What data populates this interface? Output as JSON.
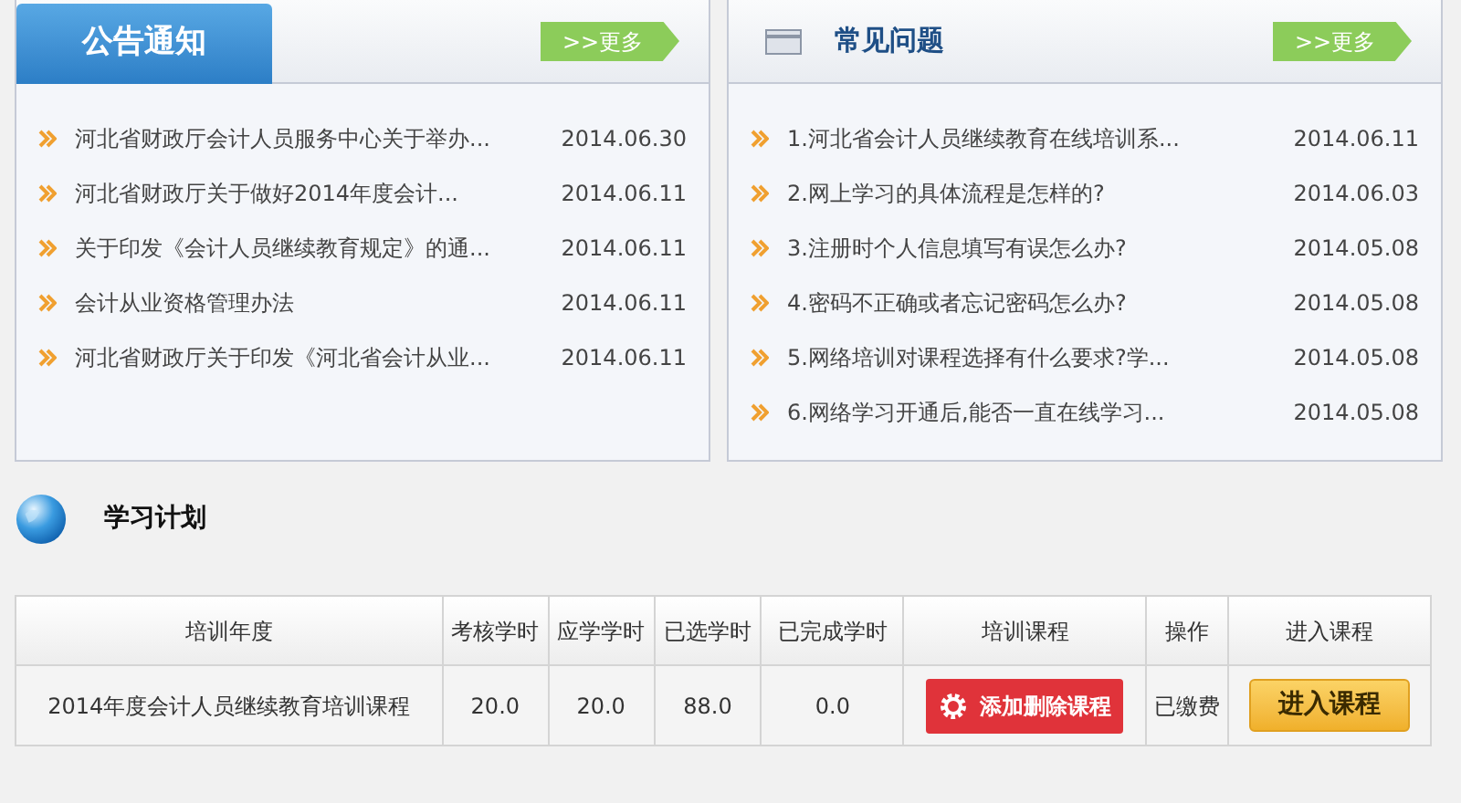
{
  "notices": {
    "title": "公告通知",
    "more": ">>更多",
    "items": [
      {
        "text": "河北省财政厅会计人员服务中心关于举办...",
        "date": "2014.06.30"
      },
      {
        "text": "河北省财政厅关于做好2014年度会计...",
        "date": "2014.06.11"
      },
      {
        "text": "关于印发《会计人员继续教育规定》的通...",
        "date": "2014.06.11"
      },
      {
        "text": "会计从业资格管理办法",
        "date": "2014.06.11"
      },
      {
        "text": "河北省财政厅关于印发《河北省会计从业...",
        "date": "2014.06.11"
      }
    ]
  },
  "faq": {
    "title": "常见问题",
    "more": ">>更多",
    "items": [
      {
        "text": "1.河北省会计人员继续教育在线培训系...",
        "date": "2014.06.11"
      },
      {
        "text": "2.网上学习的具体流程是怎样的?",
        "date": "2014.06.03"
      },
      {
        "text": "3.注册时个人信息填写有误怎么办?",
        "date": "2014.05.08"
      },
      {
        "text": "4.密码不正确或者忘记密码怎么办?",
        "date": "2014.05.08"
      },
      {
        "text": "5.网络培训对课程选择有什么要求?学...",
        "date": "2014.05.08"
      },
      {
        "text": "6.网络学习开通后,能否一直在线学习...",
        "date": "2014.05.08"
      }
    ]
  },
  "study_plan": {
    "title": "学习计划",
    "table": {
      "columns": [
        "培训年度",
        "考核学时",
        "应学学时",
        "已选学时",
        "已完成学时",
        "培训课程",
        "操作",
        "进入课程"
      ],
      "rows": [
        {
          "year": "2014年度会计人员继续教育培训课程",
          "required_hours": "20.0",
          "due_hours": "20.0",
          "selected_hours": "88.0",
          "completed_hours": "0.0",
          "course_button": "添加删除课程",
          "status": "已缴费",
          "enter_button": "进入课程"
        }
      ]
    }
  }
}
